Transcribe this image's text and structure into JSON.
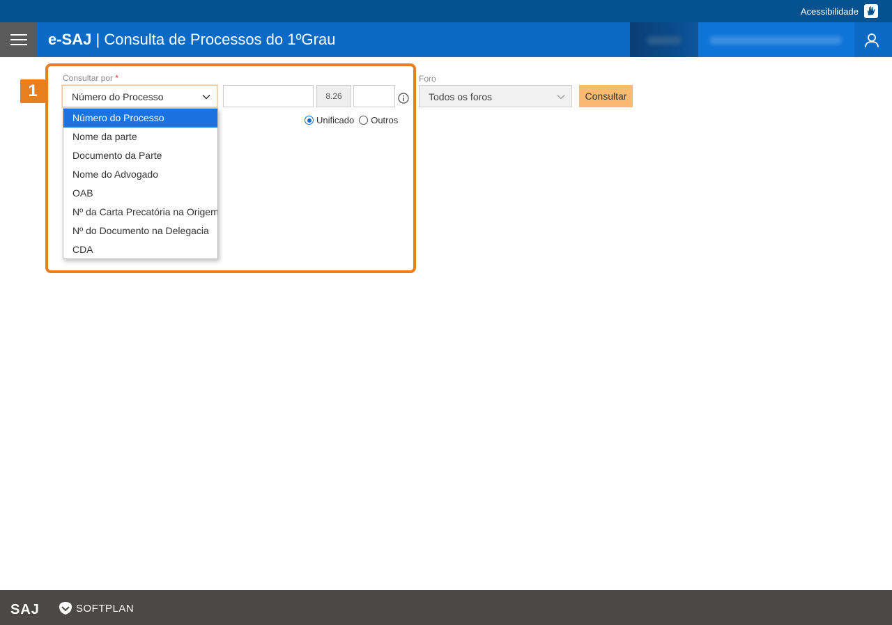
{
  "topbar": {
    "accessibility_label": "Acessibilidade"
  },
  "header": {
    "brand": "e-SAJ",
    "separator": "|",
    "title": "Consulta de Processos do 1ºGrau"
  },
  "annotation": {
    "step_number": "1"
  },
  "form": {
    "consultar_por_label": "Consultar por",
    "required_mark": "*",
    "consultar_por_value": "Número do Processo",
    "options": [
      "Número do Processo",
      "Nome da parte",
      "Documento da Parte",
      "Nome do Advogado",
      "OAB",
      "Nº da Carta Precatória na Origem",
      "Nº do Documento na Delegacia",
      "CDA"
    ],
    "numero_input_value": "",
    "segment_code": "8.26",
    "foro_numero_value": "",
    "radio_unificado": "Unificado",
    "radio_outros": "Outros",
    "foro_label": "Foro",
    "foro_value": "Todos os foros",
    "consultar_button": "Consultar"
  },
  "footer": {
    "saj_logo": "SAJ",
    "softplan_logo": "SOFTPLAN"
  },
  "colors": {
    "topbar": "#06518f",
    "header": "#0a6ac6",
    "highlight": "#e87f1e",
    "selected_option": "#1a73e0",
    "button": "#f9b96f",
    "footer": "#4b4846"
  }
}
